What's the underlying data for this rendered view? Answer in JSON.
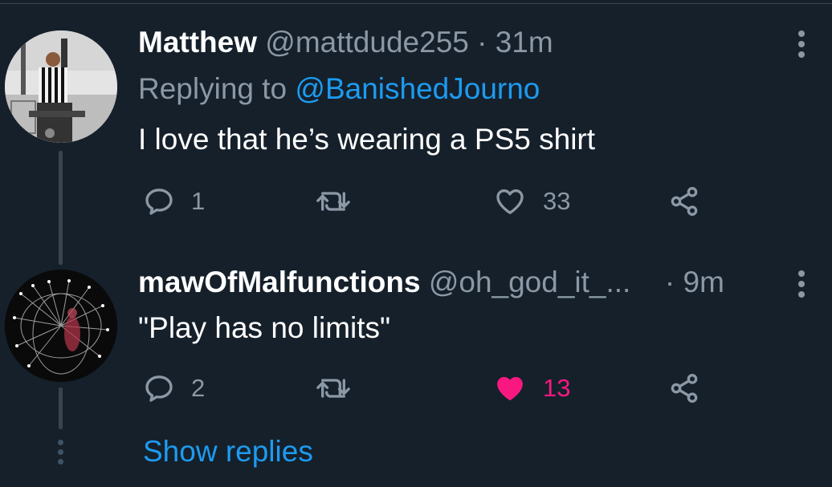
{
  "colors": {
    "background": "#15202b",
    "primary_text": "#ffffff",
    "secondary_text": "#8b98a5",
    "accent": "#1d9bf0",
    "like_active": "#f91880",
    "divider": "#38444d"
  },
  "tweets": [
    {
      "display_name": "Matthew",
      "handle": "@mattdude255",
      "separator": "·",
      "time": "31m",
      "replying_prefix": "Replying to",
      "replying_to": "@BanishedJourno",
      "text": "I love that he’s wearing a PS5 shirt",
      "avatar_icon": "referee-photo-avatar",
      "reply_count": "1",
      "like_count": "33",
      "liked": false
    },
    {
      "display_name": "mawOfMalfunctions",
      "handle": "@oh_god_it_...",
      "separator": "·",
      "time": "9m",
      "text": "\"Play has no limits\"",
      "avatar_icon": "wireframe-figure-avatar",
      "reply_count": "2",
      "like_count": "13",
      "liked": true
    }
  ],
  "show_replies_label": "Show replies",
  "icons": {
    "reply": "reply-icon",
    "retweet": "retweet-icon",
    "like": "heart-icon",
    "share": "share-icon",
    "more": "more-vertical-icon"
  }
}
